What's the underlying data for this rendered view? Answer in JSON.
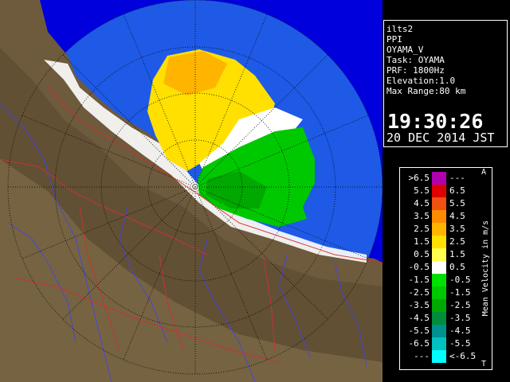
{
  "info": {
    "lines": [
      "ilts2",
      "PPI",
      "OYAMA_V",
      "Task: OYAMA",
      "PRF: 1800Hz",
      "Elevation:1.0",
      "Max Range:80 km"
    ],
    "time": "19:30:26",
    "date": "20 DEC 2014 JST"
  },
  "legend": {
    "unit_label": "Mean Velocity in m/s",
    "corner_top": "A",
    "corner_bottom": "T",
    "rows": [
      {
        "left": ">6.5",
        "right": "---",
        "color": "#b000b0"
      },
      {
        "left": "5.5",
        "right": "6.5",
        "color": "#e00000"
      },
      {
        "left": "4.5",
        "right": "5.5",
        "color": "#f05010"
      },
      {
        "left": "3.5",
        "right": "4.5",
        "color": "#ff8c00"
      },
      {
        "left": "2.5",
        "right": "3.5",
        "color": "#ffb400"
      },
      {
        "left": "1.5",
        "right": "2.5",
        "color": "#ffe000"
      },
      {
        "left": "0.5",
        "right": "1.5",
        "color": "#ffff50"
      },
      {
        "left": "-0.5",
        "right": "0.5",
        "color": "#ffffff"
      },
      {
        "left": "-1.5",
        "right": "-0.5",
        "color": "#00e000"
      },
      {
        "left": "-2.5",
        "right": "-1.5",
        "color": "#00c800"
      },
      {
        "left": "-3.5",
        "right": "-2.5",
        "color": "#00a800"
      },
      {
        "left": "-4.5",
        "right": "-3.5",
        "color": "#008c3c"
      },
      {
        "left": "-5.5",
        "right": "-4.5",
        "color": "#009090"
      },
      {
        "left": "-6.5",
        "right": "-5.5",
        "color": "#00c0c0"
      },
      {
        "left": "---",
        "right": "<-6.5",
        "color": "#00ffff"
      }
    ]
  },
  "colors": {
    "range_ring_fill": "#1e5ae6",
    "sea": "#0000dc",
    "terrain": "#6e5a3c",
    "roads": "#d03030",
    "rivers": "#4040ff"
  }
}
